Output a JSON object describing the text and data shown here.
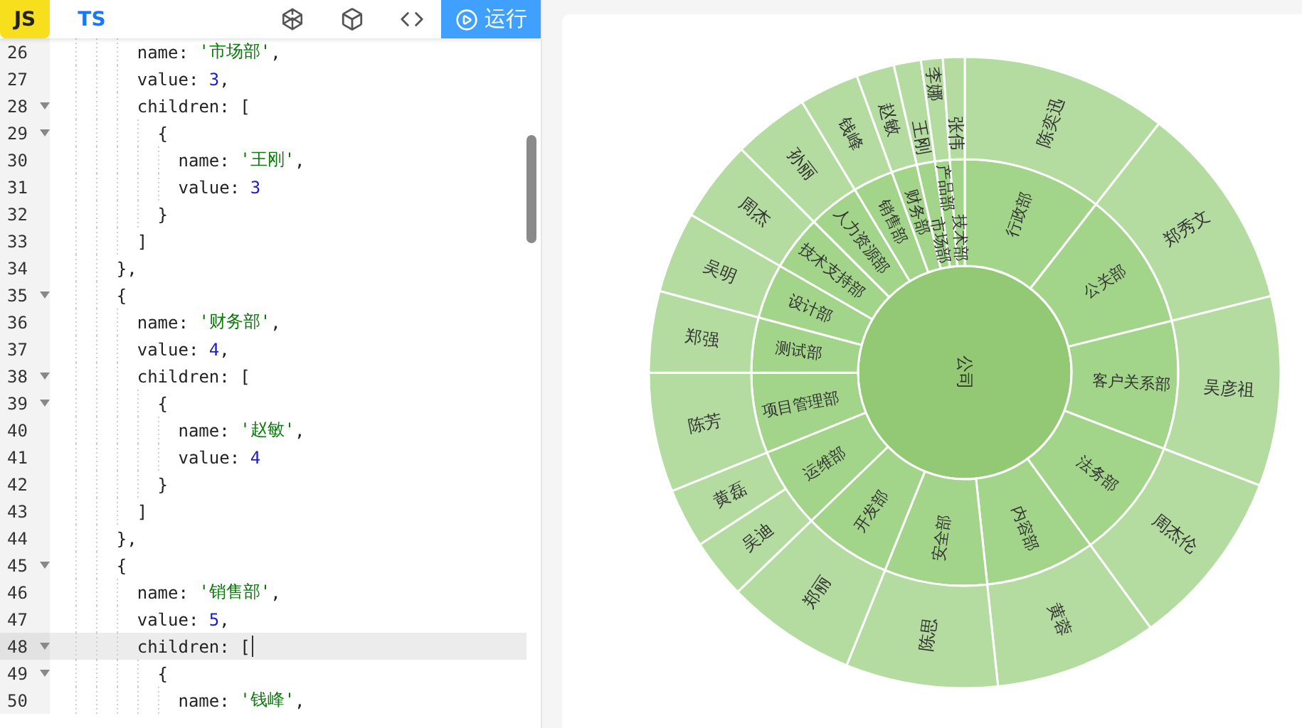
{
  "toolbar": {
    "tabs": [
      {
        "label": "JS",
        "selected": true
      },
      {
        "label": "TS",
        "selected": false
      }
    ],
    "run_button": "运行"
  },
  "editor": {
    "lines": [
      {
        "number": "26",
        "text": "      name: '市场部',",
        "foldable": false,
        "current": false
      },
      {
        "number": "27",
        "text": "      value: 3,",
        "foldable": false,
        "current": false
      },
      {
        "number": "28",
        "text": "      children: [",
        "foldable": true,
        "current": false
      },
      {
        "number": "29",
        "text": "        {",
        "foldable": true,
        "current": false
      },
      {
        "number": "30",
        "text": "          name: '王刚',",
        "foldable": false,
        "current": false
      },
      {
        "number": "31",
        "text": "          value: 3",
        "foldable": false,
        "current": false
      },
      {
        "number": "32",
        "text": "        }",
        "foldable": false,
        "current": false
      },
      {
        "number": "33",
        "text": "      ]",
        "foldable": false,
        "current": false
      },
      {
        "number": "34",
        "text": "    },",
        "foldable": false,
        "current": false
      },
      {
        "number": "35",
        "text": "    {",
        "foldable": true,
        "current": false
      },
      {
        "number": "36",
        "text": "      name: '财务部',",
        "foldable": false,
        "current": false
      },
      {
        "number": "37",
        "text": "      value: 4,",
        "foldable": false,
        "current": false
      },
      {
        "number": "38",
        "text": "      children: [",
        "foldable": true,
        "current": false
      },
      {
        "number": "39",
        "text": "        {",
        "foldable": true,
        "current": false
      },
      {
        "number": "40",
        "text": "          name: '赵敏',",
        "foldable": false,
        "current": false
      },
      {
        "number": "41",
        "text": "          value: 4",
        "foldable": false,
        "current": false
      },
      {
        "number": "42",
        "text": "        }",
        "foldable": false,
        "current": false
      },
      {
        "number": "43",
        "text": "      ]",
        "foldable": false,
        "current": false
      },
      {
        "number": "44",
        "text": "    },",
        "foldable": false,
        "current": false
      },
      {
        "number": "45",
        "text": "    {",
        "foldable": true,
        "current": false
      },
      {
        "number": "46",
        "text": "      name: '销售部',",
        "foldable": false,
        "current": false
      },
      {
        "number": "47",
        "text": "      value: 5,",
        "foldable": false,
        "current": false
      },
      {
        "number": "48",
        "text": "      children: [",
        "foldable": true,
        "current": true
      },
      {
        "number": "49",
        "text": "        {",
        "foldable": true,
        "current": false
      },
      {
        "number": "50",
        "text": "          name: '钱峰',",
        "foldable": false,
        "current": false
      }
    ]
  },
  "sunburst": {
    "center": "公司",
    "departments": {
      "chart_data": {
        "type": "donut",
        "categories": [
          "行政部",
          "公关部",
          "客户关系部",
          "法务部",
          "内容部",
          "安全部",
          "开发部",
          "运维部",
          "项目管理部",
          "测试部",
          "设计部",
          "技术支持部",
          "人力资源部",
          "销售部",
          "财务部",
          "市场部",
          "产品部",
          "技术部"
        ],
        "values": [
          10.54,
          10.56,
          9.72,
          9.17,
          8.33,
          7.78,
          6.67,
          6.11,
          6.11,
          4.17,
          4.17,
          4.17,
          3.89,
          3.06,
          1.94,
          1.39,
          1.11,
          1.11
        ]
      }
    },
    "people": {
      "chart_data": {
        "type": "donut",
        "categories": [
          "陈奕迅",
          "郑秀文",
          "吴彦祖",
          "周杰伦",
          "黄蓉",
          "陈思",
          "郑丽",
          "吴迪",
          "黄磊",
          "陈芳",
          "郑强",
          "吴明",
          "周杰",
          "孙丽",
          "钱峰",
          "赵敏",
          "王刚",
          "李娜",
          "张伟"
        ],
        "values": [
          10.54,
          10.56,
          9.72,
          9.17,
          8.33,
          7.78,
          6.67,
          3.06,
          3.05,
          6.11,
          4.17,
          4.17,
          4.17,
          3.89,
          3.06,
          1.94,
          1.39,
          1.11,
          1.11
        ]
      }
    }
  }
}
